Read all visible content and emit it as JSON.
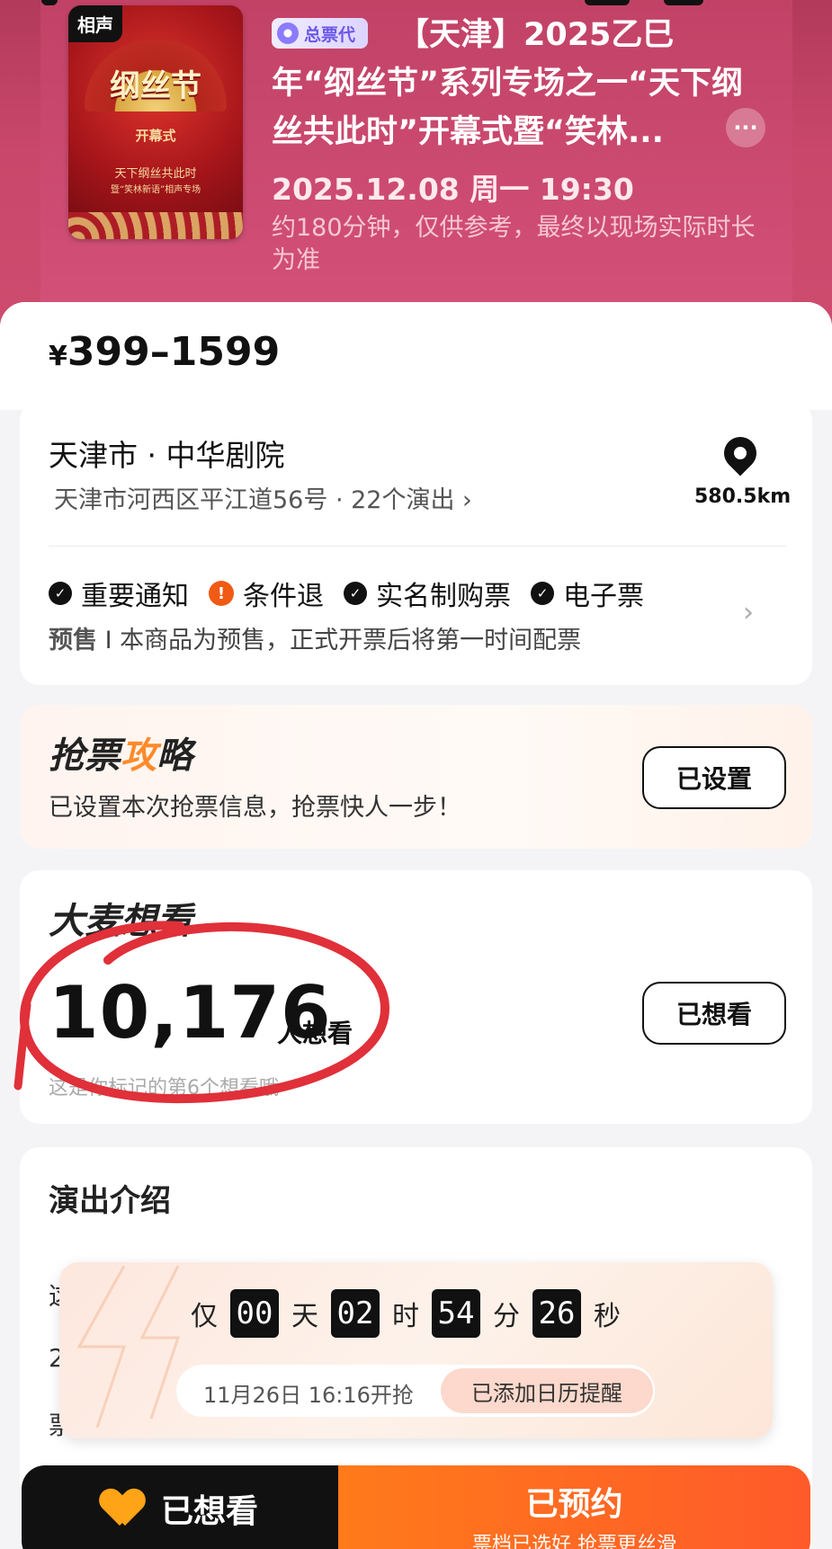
{
  "show": {
    "genre_tag": "相声",
    "poster_title": "纲丝节",
    "poster_subtitle": "开幕式",
    "poster_lines": [
      "天下纲丝共此时",
      "暨“笑林新语”相声专场"
    ],
    "badge": "总票代",
    "title": "【天津】2025乙巳年“纲丝节”系列专场之一“天下纲丝共此时”开幕式暨“笑林...",
    "datetime": "2025.12.08 周一 19:30",
    "duration": "约180分钟，仅供参考，最终以现场实际时长为准",
    "more": "···"
  },
  "price": {
    "currency": "¥",
    "range": "399–1599"
  },
  "venue": {
    "name": "天津市 · 中华剧院",
    "address": "天津市河西区平江道56号 · 22个演出 ›",
    "distance": "580.5km"
  },
  "services": [
    {
      "label": "重要通知",
      "icon": "check"
    },
    {
      "label": "条件退",
      "icon": "warning"
    },
    {
      "label": "实名制购票",
      "icon": "check"
    },
    {
      "label": "电子票",
      "icon": "check"
    }
  ],
  "presale": {
    "tag": "预售",
    "sep": "I",
    "text": "本商品为预售，正式开票后将第一时间配票"
  },
  "strategy": {
    "title_a": "抢票",
    "title_b": "攻",
    "title_c": "略",
    "desc": "已设置本次抢票信息，抢票快人一步！",
    "button": "已设置"
  },
  "want": {
    "title": "大麦想看",
    "count": "10,176",
    "suffix": "人想看",
    "sub": "这是你标记的第6个想看哦",
    "button": "已想看"
  },
  "intro": {
    "title": "演出介绍",
    "glimpse": [
      "这",
      "2",
      "票"
    ]
  },
  "countdown": {
    "prefix": "仅",
    "days": "00",
    "days_unit": "天",
    "hours": "02",
    "hours_unit": "时",
    "minutes": "54",
    "minutes_unit": "分",
    "seconds": "26",
    "seconds_unit": "秒",
    "start": "11月26日 16:16开抢",
    "remind": "已添加日历提醒"
  },
  "bottom": {
    "want_label": "已想看",
    "main": "已预约",
    "sub": "票档已选好 抢票更丝滑"
  },
  "colors": {
    "header": "#c9476a",
    "accent": "#ff6a1f",
    "mark": "#e0303a"
  }
}
